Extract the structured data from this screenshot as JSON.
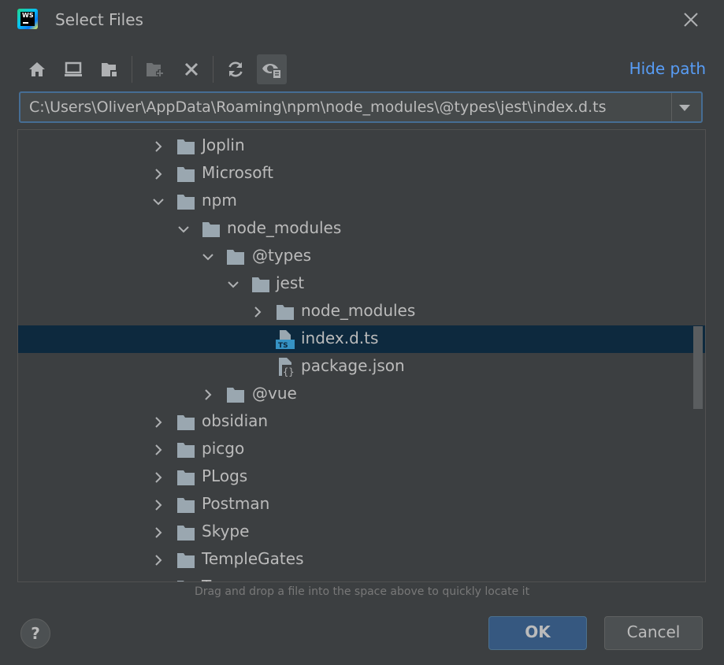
{
  "dialog": {
    "title": "Select Files",
    "app_icon_text": "WS"
  },
  "toolbar": {
    "buttons": [
      {
        "name": "home-icon"
      },
      {
        "name": "desktop-icon"
      },
      {
        "name": "project-folder-icon"
      },
      {
        "name": "new-folder-icon"
      },
      {
        "name": "delete-icon"
      },
      {
        "name": "refresh-icon"
      },
      {
        "name": "show-hidden-icon"
      }
    ],
    "hide_path_label": "Hide path"
  },
  "path": {
    "value": "C:\\Users\\Oliver\\AppData\\Roaming\\npm\\node_modules\\@types\\jest\\index.d.ts"
  },
  "tree": {
    "rows": [
      {
        "label": "Joplin",
        "type": "folder",
        "expanded": false
      },
      {
        "label": "Microsoft",
        "type": "folder",
        "expanded": false
      },
      {
        "label": "npm",
        "type": "folder",
        "expanded": true
      },
      {
        "label": "node_modules",
        "type": "folder",
        "expanded": true
      },
      {
        "label": "@types",
        "type": "folder",
        "expanded": true
      },
      {
        "label": "jest",
        "type": "folder",
        "expanded": true
      },
      {
        "label": "node_modules",
        "type": "folder",
        "expanded": false
      },
      {
        "label": "index.d.ts",
        "type": "ts-file",
        "selected": true
      },
      {
        "label": "package.json",
        "type": "json-file"
      },
      {
        "label": "@vue",
        "type": "folder",
        "expanded": false
      },
      {
        "label": "obsidian",
        "type": "folder",
        "expanded": false
      },
      {
        "label": "picgo",
        "type": "folder",
        "expanded": false
      },
      {
        "label": "PLogs",
        "type": "folder",
        "expanded": false
      },
      {
        "label": "Postman",
        "type": "folder",
        "expanded": false
      },
      {
        "label": "Skype",
        "type": "folder",
        "expanded": false
      },
      {
        "label": "TempleGates",
        "type": "folder",
        "expanded": false
      },
      {
        "label": "T",
        "type": "folder",
        "expanded": false
      }
    ]
  },
  "hint": "Drag and drop a file into the space above to quickly locate it",
  "footer": {
    "help_label": "?",
    "ok_label": "OK",
    "cancel_label": "Cancel"
  },
  "colors": {
    "background": "#3c3f41",
    "selection": "#0d293e",
    "link": "#589df6",
    "folder": "#9aa7b0",
    "ok_button": "#365880"
  }
}
